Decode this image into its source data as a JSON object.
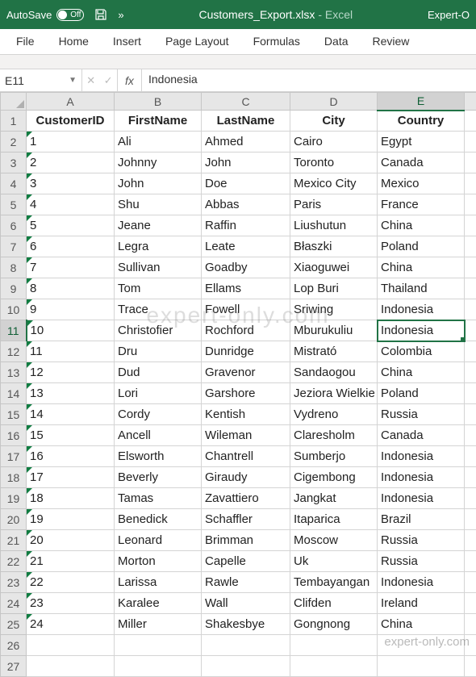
{
  "titlebar": {
    "autosave_label": "AutoSave",
    "autosave_state": "Off",
    "filename": "Customers_Export.xlsx",
    "app": "Excel",
    "right_text": "Expert-O"
  },
  "tabs": [
    "File",
    "Home",
    "Insert",
    "Page Layout",
    "Formulas",
    "Data",
    "Review"
  ],
  "namebox": "E11",
  "formula": "Indonesia",
  "fx_label": "fx",
  "columns": [
    "A",
    "B",
    "C",
    "D",
    "E"
  ],
  "active_col": "E",
  "active_row": 11,
  "headers": [
    "CustomerID",
    "FirstName",
    "LastName",
    "City",
    "Country"
  ],
  "chart_data": {
    "type": "table",
    "title": "Customers_Export",
    "columns": [
      "CustomerID",
      "FirstName",
      "LastName",
      "City",
      "Country"
    ],
    "rows": [
      [
        "1",
        "Ali",
        "Ahmed",
        "Cairo",
        "Egypt"
      ],
      [
        "2",
        "Johnny",
        "John",
        "Toronto",
        "Canada"
      ],
      [
        "3",
        "John",
        "Doe",
        "Mexico City",
        "Mexico"
      ],
      [
        "4",
        "Shu",
        "Abbas",
        "Paris",
        "France"
      ],
      [
        "5",
        "Jeane",
        "Raffin",
        "Liushutun",
        "China"
      ],
      [
        "6",
        "Legra",
        "Leate",
        "Błaszki",
        "Poland"
      ],
      [
        "7",
        "Sullivan",
        "Goadby",
        "Xiaoguwei",
        "China"
      ],
      [
        "8",
        "Tom",
        "Ellams",
        "Lop Buri",
        "Thailand"
      ],
      [
        "9",
        "Trace",
        "Fowell",
        "Sriwing",
        "Indonesia"
      ],
      [
        "10",
        "Christofier",
        "Rochford",
        "Mburukuliu",
        "Indonesia"
      ],
      [
        "11",
        "Dru",
        "Dunridge",
        "Mistrató",
        "Colombia"
      ],
      [
        "12",
        "Dud",
        "Gravenor",
        "Sandaogou",
        "China"
      ],
      [
        "13",
        "Lori",
        "Garshore",
        "Jeziora Wielkie",
        "Poland"
      ],
      [
        "14",
        "Cordy",
        "Kentish",
        "Vydreno",
        "Russia"
      ],
      [
        "15",
        "Ancell",
        "Wileman",
        "Claresholm",
        "Canada"
      ],
      [
        "16",
        "Elsworth",
        "Chantrell",
        "Sumberjo",
        "Indonesia"
      ],
      [
        "17",
        "Beverly",
        "Giraudy",
        "Cigembong",
        "Indonesia"
      ],
      [
        "18",
        "Tamas",
        "Zavattiero",
        "Jangkat",
        "Indonesia"
      ],
      [
        "19",
        "Benedick",
        "Schaffler",
        "Itaparica",
        "Brazil"
      ],
      [
        "20",
        "Leonard",
        "Brimman",
        "Moscow",
        "Russia"
      ],
      [
        "21",
        "Morton",
        "Capelle",
        "Uk",
        "Russia"
      ],
      [
        "22",
        "Larissa",
        "Rawle",
        "Tembayangan",
        "Indonesia"
      ],
      [
        "23",
        "Karalee",
        "Wall",
        "Clifden",
        "Ireland"
      ],
      [
        "24",
        "Miller",
        "Shakesbye",
        "Gongnong",
        "China"
      ]
    ]
  },
  "empty_rows": [
    26,
    27
  ],
  "watermark": "expert-only.com",
  "watermark2": "expert-only.com"
}
